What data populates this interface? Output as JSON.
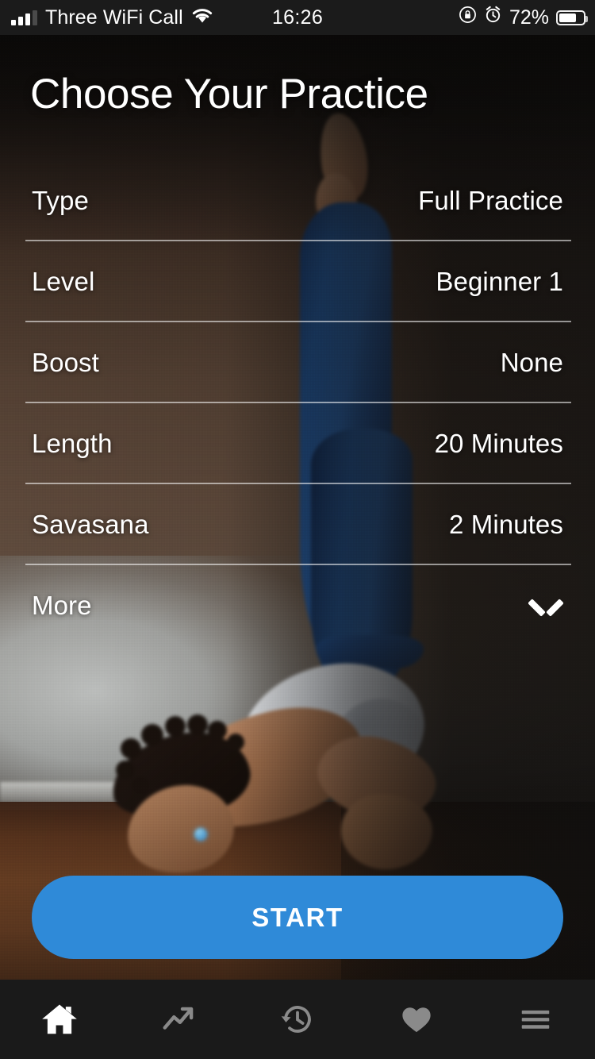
{
  "status_bar": {
    "signal_icon": "signal-bars-icon",
    "carrier": "Three WiFi Call",
    "wifi_icon": "wifi-icon",
    "time": "16:26",
    "rotation_lock_icon": "rotation-lock-icon",
    "alarm_icon": "alarm-clock-icon",
    "battery_percent": "72%",
    "battery_icon": "battery-icon"
  },
  "header": {
    "title": "Choose Your Practice"
  },
  "options": [
    {
      "label": "Type",
      "value": "Full Practice"
    },
    {
      "label": "Level",
      "value": "Beginner 1"
    },
    {
      "label": "Boost",
      "value": "None"
    },
    {
      "label": "Length",
      "value": "20 Minutes"
    },
    {
      "label": "Savasana",
      "value": "2 Minutes"
    },
    {
      "label": "More",
      "value": "",
      "icon": "chevron-down-icon"
    }
  ],
  "start_button": {
    "label": "START",
    "color": "#2f8ad8"
  },
  "bottom_nav": {
    "items": [
      {
        "name": "home",
        "icon": "home-icon",
        "active": true
      },
      {
        "name": "progress",
        "icon": "trending-up-icon",
        "active": false
      },
      {
        "name": "history",
        "icon": "history-icon",
        "active": false
      },
      {
        "name": "favorites",
        "icon": "heart-icon",
        "active": false
      },
      {
        "name": "menu",
        "icon": "hamburger-menu-icon",
        "active": false
      }
    ]
  }
}
